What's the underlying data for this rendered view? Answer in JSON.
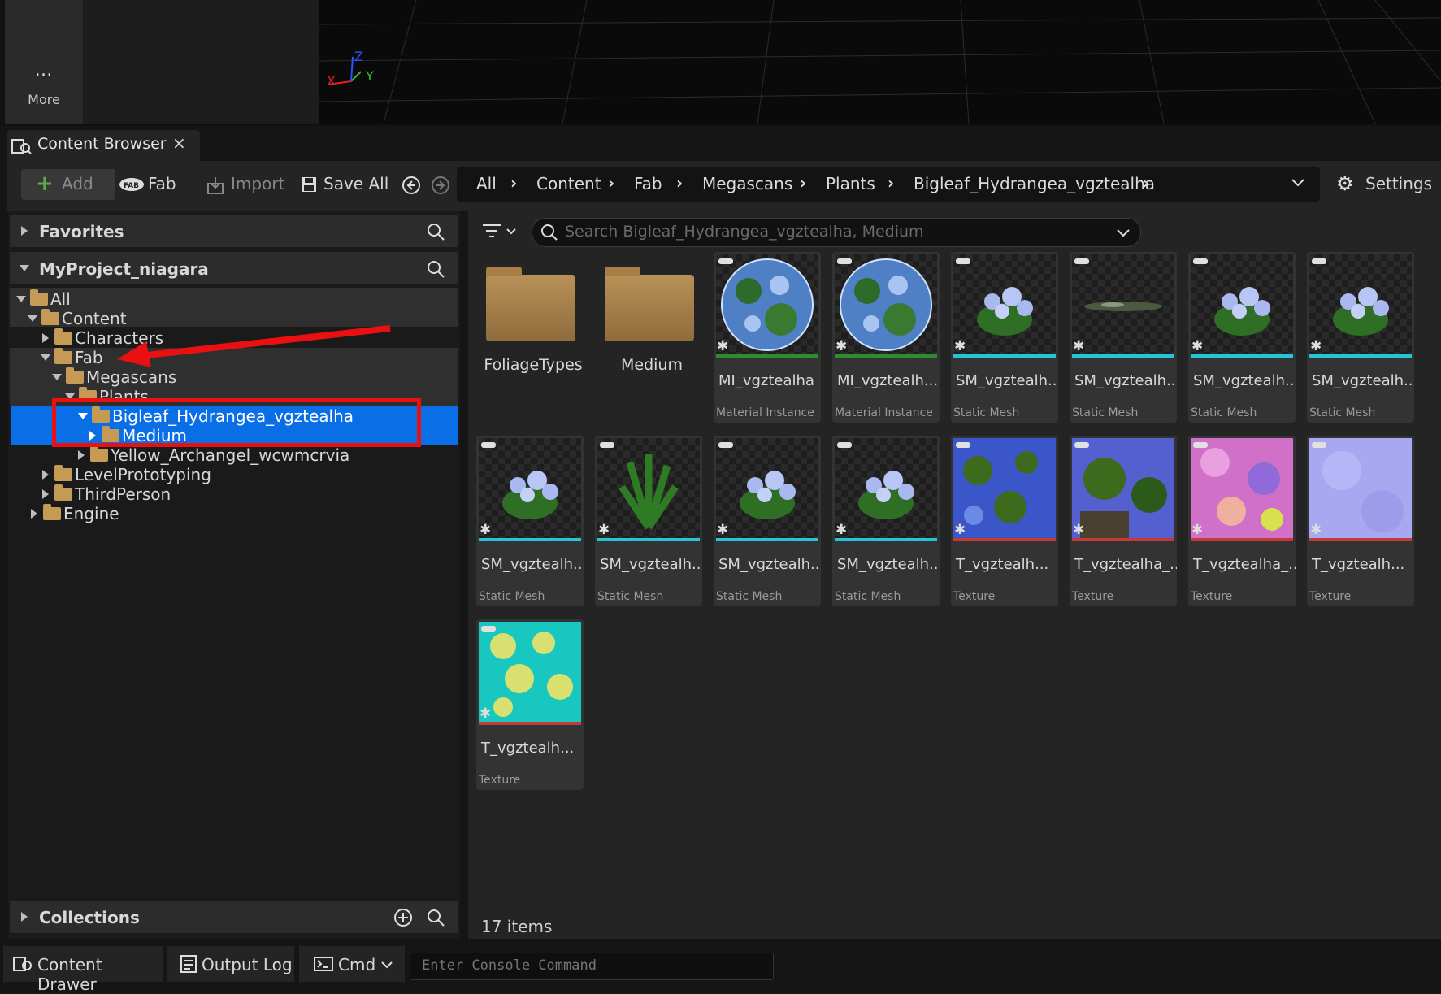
{
  "top": {
    "more_label": "More",
    "more_dots": "…",
    "axis_x": "X",
    "axis_y": "Y",
    "axis_z": "Z"
  },
  "tab": {
    "title": "Content Browser",
    "close": "×"
  },
  "toolbar": {
    "add": "Add",
    "fab": "Fab",
    "import": "Import",
    "save_all": "Save All",
    "settings": "Settings",
    "breadcrumbs": [
      "All",
      "Content",
      "Fab",
      "Megascans",
      "Plants",
      "Bigleaf_Hydrangea_vgztealha"
    ]
  },
  "left": {
    "favorites": "Favorites",
    "project": "MyProject_niagara",
    "collections": "Collections",
    "tree": [
      {
        "label": "All",
        "depth": 0,
        "state": "open"
      },
      {
        "label": "Content",
        "depth": 1,
        "state": "open"
      },
      {
        "label": "Characters",
        "depth": 2,
        "state": "closed"
      },
      {
        "label": "Fab",
        "depth": 2,
        "state": "open"
      },
      {
        "label": "Megascans",
        "depth": 3,
        "state": "open"
      },
      {
        "label": "Plants",
        "depth": 4,
        "state": "open"
      },
      {
        "label": "Bigleaf_Hydrangea_vgztealha",
        "depth": 5,
        "state": "open",
        "selected": true
      },
      {
        "label": "Medium",
        "depth": 6,
        "state": "closed",
        "selected": true
      },
      {
        "label": "Yellow_Archangel_wcwmcrvia",
        "depth": 5,
        "state": "closed"
      },
      {
        "label": "LevelPrototyping",
        "depth": 2,
        "state": "closed"
      },
      {
        "label": "ThirdPerson",
        "depth": 2,
        "state": "closed"
      },
      {
        "label": "Engine",
        "depth": 1,
        "state": "closed"
      }
    ]
  },
  "right": {
    "search_placeholder": "Search Bigleaf_Hydrangea_vgztealha, Medium",
    "item_count": "17 items",
    "folders": [
      "FoliageTypes",
      "Medium"
    ],
    "assets": [
      {
        "name": "MI_vgztealha",
        "type": "Material Instance",
        "kind": "mi",
        "strip": "#2e8b2e"
      },
      {
        "name": "MI_vgztealh...",
        "type": "Material Instance",
        "kind": "mi",
        "strip": "#2e8b2e"
      },
      {
        "name": "SM_vgztealh...",
        "type": "Static Mesh",
        "kind": "plant",
        "strip": "#27c4d8"
      },
      {
        "name": "SM_vgztealh...",
        "type": "Static Mesh",
        "kind": "flat",
        "strip": "#27c4d8"
      },
      {
        "name": "SM_vgztealh...",
        "type": "Static Mesh",
        "kind": "plant",
        "strip": "#27c4d8"
      },
      {
        "name": "SM_vgztealh...",
        "type": "Static Mesh",
        "kind": "plant",
        "strip": "#27c4d8"
      },
      {
        "name": "SM_vgztealh...",
        "type": "Static Mesh",
        "kind": "plant",
        "strip": "#27c4d8"
      },
      {
        "name": "SM_vgztealh...",
        "type": "Static Mesh",
        "kind": "leaf",
        "strip": "#27c4d8"
      },
      {
        "name": "SM_vgztealh...",
        "type": "Static Mesh",
        "kind": "plant",
        "strip": "#27c4d8"
      },
      {
        "name": "SM_vgztealh...",
        "type": "Static Mesh",
        "kind": "plant",
        "strip": "#27c4d8"
      },
      {
        "name": "T_vgztealh...",
        "type": "Texture",
        "kind": "tex-blue",
        "strip": "#c23a3a"
      },
      {
        "name": "T_vgztealha_...",
        "type": "Texture",
        "kind": "tex-mix",
        "strip": "#c23a3a"
      },
      {
        "name": "T_vgztealha_...",
        "type": "Texture",
        "kind": "tex-pink",
        "strip": "#c23a3a"
      },
      {
        "name": "T_vgztealh...",
        "type": "Texture",
        "kind": "tex-lav",
        "strip": "#c23a3a"
      },
      {
        "name": "T_vgztealh...",
        "type": "Texture",
        "kind": "tex-cyan",
        "strip": "#c23a3a"
      }
    ]
  },
  "bottom": {
    "content_drawer": "Content Drawer",
    "output_log": "Output Log",
    "cmd": "Cmd",
    "console_placeholder": "Enter Console Command"
  },
  "colors": {
    "selection": "#0a6ee6",
    "annotation": "#e81010"
  }
}
